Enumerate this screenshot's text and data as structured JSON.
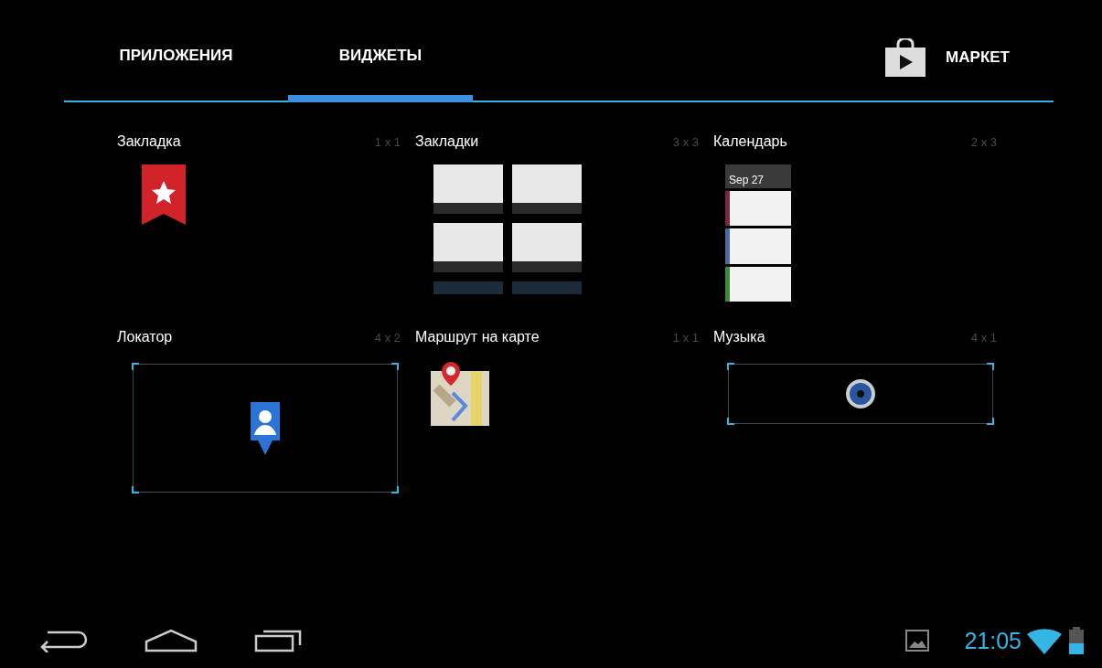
{
  "tabs": [
    {
      "label": "ПРИЛОЖЕНИЯ",
      "selected": false
    },
    {
      "label": "ВИДЖЕТЫ",
      "selected": true
    }
  ],
  "market": {
    "label": "МАРКЕТ"
  },
  "widgets": [
    {
      "name": "Закладка",
      "size": "1 x 1",
      "kind": "bookmark"
    },
    {
      "name": "Закладки",
      "size": "3 x 3",
      "kind": "bookmarks"
    },
    {
      "name": "Календарь",
      "size": "2 x 3",
      "kind": "calendar",
      "date": "Sep 27"
    },
    {
      "name": "Локатор",
      "size": "4 x 2",
      "kind": "locator"
    },
    {
      "name": "Маршрут на карте",
      "size": "1 x 1",
      "kind": "route"
    },
    {
      "name": "Музыка",
      "size": "4 x 1",
      "kind": "music"
    }
  ],
  "status_bar": {
    "time": "21:05"
  }
}
